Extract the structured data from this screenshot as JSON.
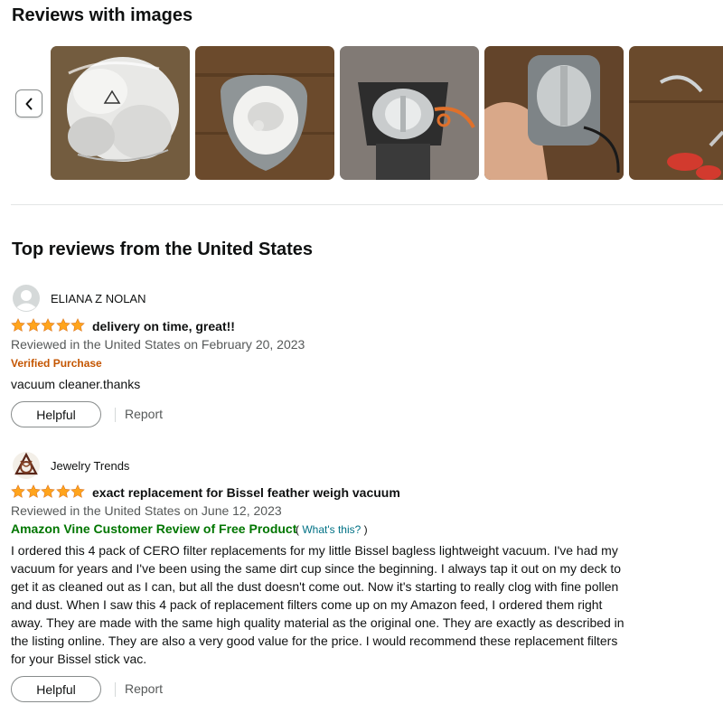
{
  "images_section": {
    "title": "Reviews with images",
    "prev_icon": "chevron-left-icon"
  },
  "top_reviews": {
    "title": "Top reviews from the United States"
  },
  "colors": {
    "star": "#ffa41c",
    "verified": "#c45500",
    "vine": "#007600",
    "link": "#007185",
    "meta": "#565959"
  },
  "reviews": [
    {
      "author": "ELIANA Z NOLAN",
      "rating": 5,
      "title": "delivery on time, great!!",
      "meta": "Reviewed in the United States on February 20, 2023",
      "badge": "Verified Purchase",
      "body": "vacuum cleaner.thanks",
      "helpful_label": "Helpful",
      "report_label": "Report"
    },
    {
      "author": "Jewelry Trends",
      "rating": 5,
      "title": "exact replacement for Bissel feather weigh vacuum",
      "meta": "Reviewed in the United States on June 12, 2023",
      "badge": "Amazon Vine Customer Review of Free Product",
      "badge_link_open": "(",
      "badge_link": "What's this?",
      "badge_link_close": ")",
      "body": "I ordered this 4 pack of CERO filter replacements for my little Bissel bagless lightweight vacuum. I've had my vacuum for years and I've been using the same dirt cup since the beginning. I always tap it out on my deck to get it as cleaned out as I can, but all the dust doesn't come out. Now it's starting to really clog with fine pollen and dust. When I saw this 4 pack of replacement filters come up on my Amazon feed, I ordered them right away. They are made with the same high quality material as the original one. They are exactly as described in the listing online. They are also a very good value for the price. I would recommend these replacement filters for your Bissel stick vac.",
      "helpful_label": "Helpful",
      "report_label": "Report"
    }
  ]
}
